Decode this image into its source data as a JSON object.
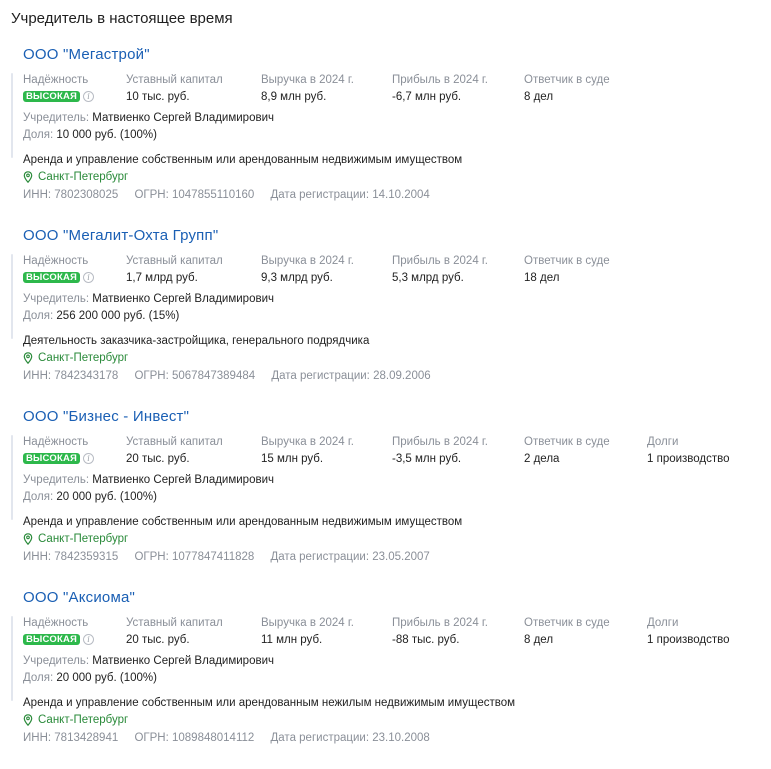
{
  "section_title": "Учредитель в настоящее время",
  "labels": {
    "reliability": "Надёжность",
    "capital": "Уставный капитал",
    "revenue": "Выручка в 2024 г.",
    "profit": "Прибыль в 2024 г.",
    "defendant": "Ответчик в суде",
    "debts": "Долги",
    "founder": "Учредитель:",
    "share": "Доля:",
    "inn": "ИНН:",
    "ogrn": "ОГРН:",
    "reg_date": "Дата регистрации:"
  },
  "reliability_badge": "ВЫСОКАЯ",
  "info_icon_glyph": "i",
  "colors": {
    "link": "#1a5fb4",
    "badge_green": "#2db84b",
    "location_green": "#2a8a3a",
    "muted": "#8a8f98"
  },
  "companies": [
    {
      "name": "ООО \"Мегастрой\"",
      "capital": "10 тыс. руб.",
      "revenue": "8,9 млн руб.",
      "profit": "-6,7 млн руб.",
      "defendant": "8 дел",
      "debts": null,
      "founder": "Матвиенко Сергей Владимирович",
      "share": "10 000 руб. (100%)",
      "activity": "Аренда и управление собственным или арендованным недвижимым имуществом",
      "location": "Санкт-Петербург",
      "inn": "7802308025",
      "ogrn": "1047855110160",
      "reg_date": "14.10.2004"
    },
    {
      "name": "ООО \"Мегалит-Охта Групп\"",
      "capital": "1,7 млрд руб.",
      "revenue": "9,3 млрд руб.",
      "profit": "5,3 млрд руб.",
      "defendant": "18 дел",
      "debts": null,
      "founder": "Матвиенко Сергей Владимирович",
      "share": "256 200 000 руб. (15%)",
      "activity": "Деятельность заказчика-застройщика, генерального подрядчика",
      "location": "Санкт-Петербург",
      "inn": "7842343178",
      "ogrn": "5067847389484",
      "reg_date": "28.09.2006"
    },
    {
      "name": "ООО \"Бизнес - Инвест\"",
      "capital": "20 тыс. руб.",
      "revenue": "15 млн руб.",
      "profit": "-3,5 млн руб.",
      "defendant": "2 дела",
      "debts": "1 производство",
      "founder": "Матвиенко Сергей Владимирович",
      "share": "20 000 руб. (100%)",
      "activity": "Аренда и управление собственным или арендованным недвижимым имуществом",
      "location": "Санкт-Петербург",
      "inn": "7842359315",
      "ogrn": "1077847411828",
      "reg_date": "23.05.2007"
    },
    {
      "name": "ООО \"Аксиома\"",
      "capital": "20 тыс. руб.",
      "revenue": "11 млн руб.",
      "profit": "-88 тыс. руб.",
      "defendant": "8 дел",
      "debts": "1 производство",
      "founder": "Матвиенко Сергей Владимирович",
      "share": "20 000 руб. (100%)",
      "activity": "Аренда и управление собственным или арендованным нежилым недвижимым имуществом",
      "location": "Санкт-Петербург",
      "inn": "7813428941",
      "ogrn": "1089848014112",
      "reg_date": "23.10.2008"
    }
  ]
}
